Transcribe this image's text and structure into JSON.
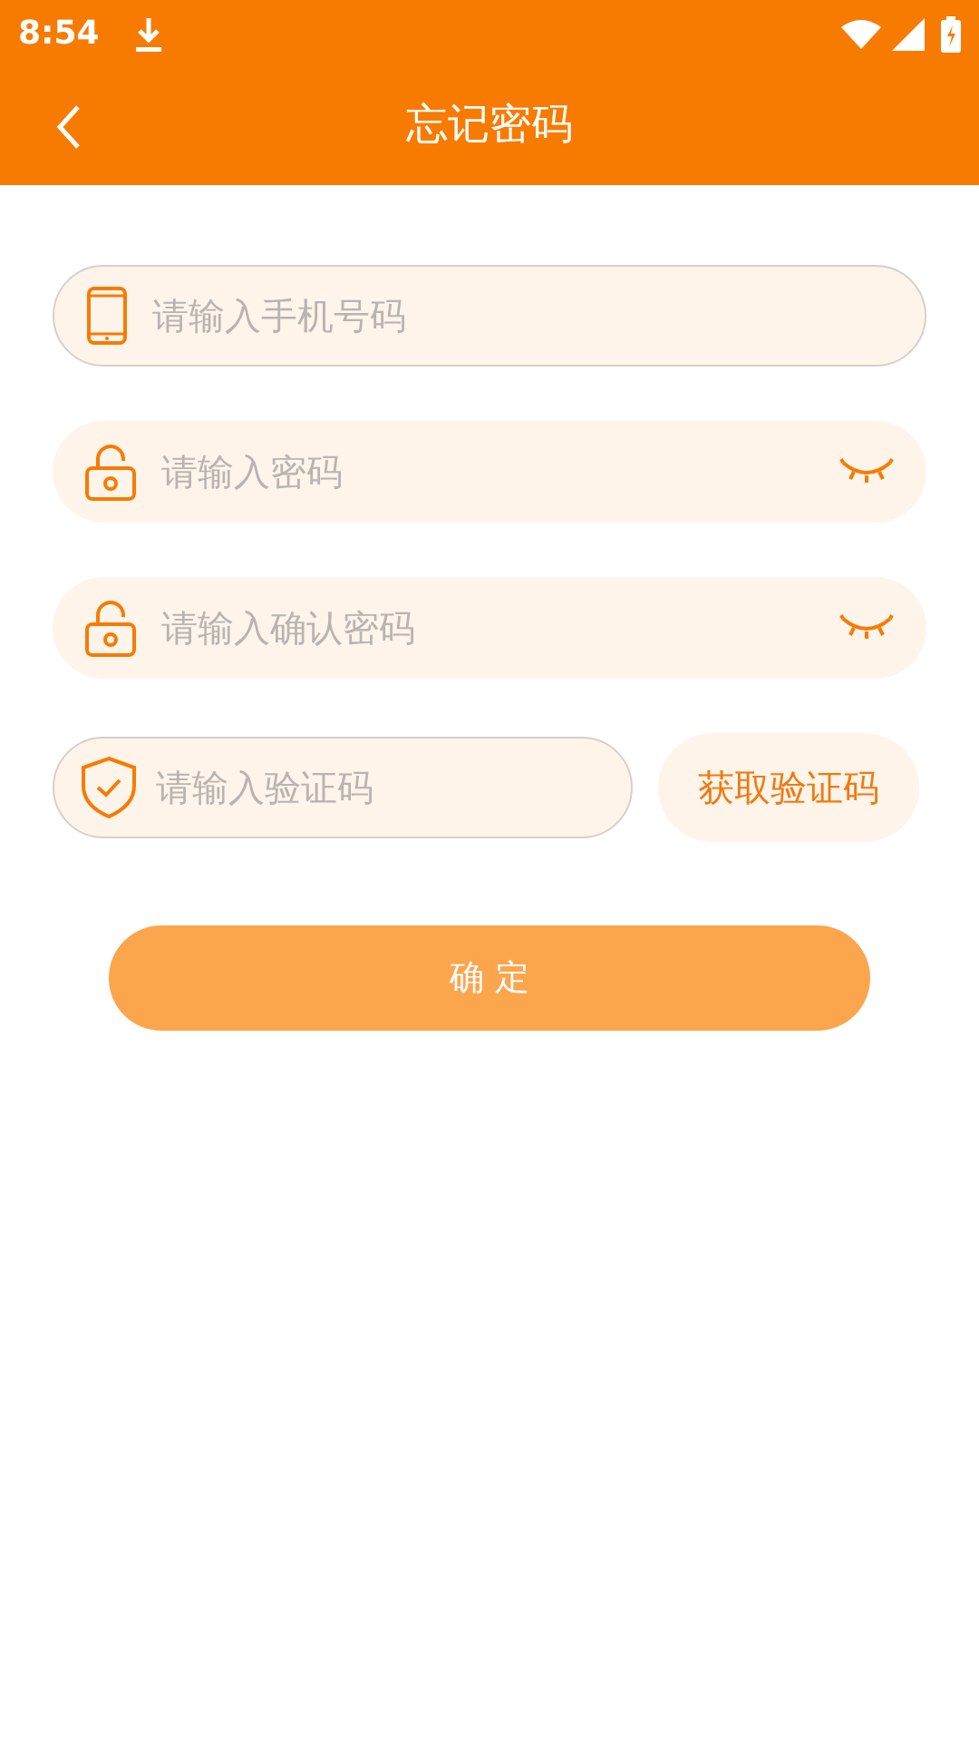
{
  "status_bar": {
    "time": "8:54"
  },
  "header": {
    "title": "忘记密码"
  },
  "fields": [
    {
      "kind": "phone",
      "placeholder": "请输入手机号码",
      "bordered": true,
      "secret": false
    },
    {
      "kind": "lock",
      "placeholder": "请输入密码",
      "bordered": false,
      "secret": true
    },
    {
      "kind": "lock",
      "placeholder": "请输入确认密码",
      "bordered": false,
      "secret": true
    }
  ],
  "code_field": {
    "kind": "shield",
    "placeholder": "请输入验证码",
    "bordered": true
  },
  "code_button": "获取验证码",
  "submit_button": "确 定"
}
